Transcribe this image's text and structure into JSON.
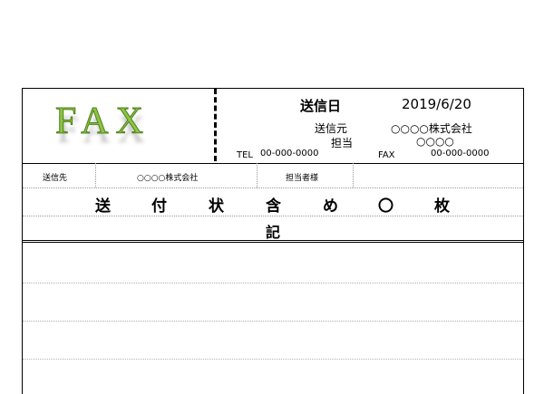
{
  "header": {
    "logo": "FAX",
    "send_date_label": "送信日",
    "send_date": "2019/6/20",
    "sender_label": "送信元",
    "sender_company": "○○○○株式会社",
    "person_label": "担当",
    "person_name": "○○○○",
    "tel_label": "TEL",
    "tel_value": "00-000-0000",
    "fax_label": "FAX",
    "fax_value": "00-000-0000"
  },
  "recipient": {
    "label": "送信先",
    "company": "○○○○株式会社",
    "person": "担当者様"
  },
  "cover_line": [
    "送",
    "付",
    "状",
    "含",
    "め",
    "〇",
    "枚"
  ],
  "note_label": "記"
}
